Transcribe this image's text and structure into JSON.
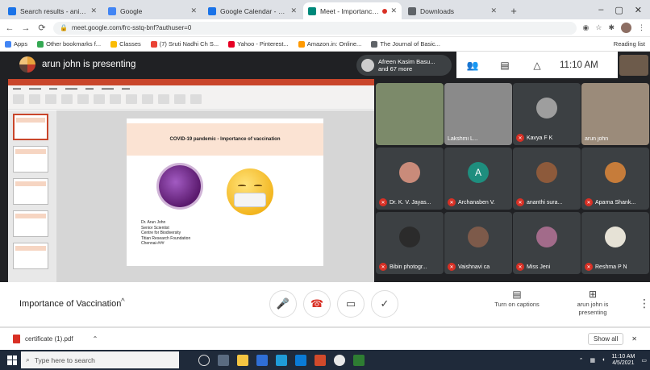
{
  "browser": {
    "tabs": [
      {
        "title": "Search results - anilajayan@...",
        "active": false,
        "color": "#1a73e8"
      },
      {
        "title": "Google",
        "active": false,
        "color": "#4285f4"
      },
      {
        "title": "Google Calendar - Weekly...",
        "active": false,
        "color": "#1a73e8"
      },
      {
        "title": "Meet - Importance of Va...",
        "active": true,
        "color": "#00897b"
      },
      {
        "title": "Downloads",
        "active": false,
        "color": "#5f6368"
      }
    ],
    "new_tab": "+",
    "url": "meet.google.com/frc-sstq-bnf?authuser=0",
    "bookmarks": [
      {
        "label": "Apps",
        "color": "#4285f4"
      },
      {
        "label": "Other bookmarks f...",
        "color": "#34a853"
      },
      {
        "label": "Classes",
        "color": "#fbbc05"
      },
      {
        "label": "(7) Sruti Nadhi Ch S...",
        "color": "#ea4335"
      },
      {
        "label": "Yahoo - Pinterest...",
        "color": "#e60023"
      },
      {
        "label": "Amazon.in: Online...",
        "color": "#ff9900"
      },
      {
        "label": "The Journal of Basic...",
        "color": "#5f6368"
      }
    ],
    "reading_list": "Reading list"
  },
  "meet": {
    "presenting_label": "arun john is presenting",
    "presenter_pill": "Afreen Kasim Basu... and 67 more",
    "clock": "11:10 AM",
    "meeting_title": "Importance of Vaccination",
    "caret": "^",
    "captions_label": "Turn on captions",
    "presenting_ctl_label": "arun john is presenting",
    "participants": [
      {
        "name": "",
        "type": "video",
        "color": "#7c8a6a"
      },
      {
        "name": "Lakshmi L...",
        "type": "video",
        "color": "#8a8a8a"
      },
      {
        "name": "Kavya F K",
        "type": "avatar",
        "color": "#9e9e9e",
        "letter": ""
      },
      {
        "name": "arun john",
        "type": "video",
        "color": "#9b8b7a"
      },
      {
        "name": "Dr. K. V. Jayas...",
        "type": "avatar",
        "color": "#c98b7a",
        "letter": ""
      },
      {
        "name": "Archanaben V.",
        "type": "avatar",
        "color": "#1e8e7e",
        "letter": "A"
      },
      {
        "name": "ananthi sura...",
        "type": "avatar",
        "color": "#8d5a3b",
        "letter": ""
      },
      {
        "name": "Aparna Shank...",
        "type": "avatar",
        "color": "#c67c3a",
        "letter": ""
      },
      {
        "name": "Bibin photogr...",
        "type": "avatar",
        "color": "#2b2b2b",
        "letter": ""
      },
      {
        "name": "Vaishnavi ca",
        "type": "avatar",
        "color": "#7d5a4a",
        "letter": ""
      },
      {
        "name": "Miss Jeni",
        "type": "avatar",
        "color": "#a26b8a",
        "letter": ""
      },
      {
        "name": "Reshma P N",
        "type": "avatar",
        "color": "#e6e2d6",
        "letter": ""
      }
    ]
  },
  "slide": {
    "header": "COVID-19 pandemic - Importance of vaccination",
    "author_lines": [
      "Dr. Arun John",
      "Senior Scientist",
      "Centre for Biodiversity",
      "Titian Research Foundation",
      "Chennai-###"
    ]
  },
  "downloads": {
    "file": "certificate (1).pdf",
    "show_all": "Show all"
  },
  "taskbar": {
    "search_placeholder": "Type here to search",
    "time": "11:10 AM",
    "date": "4/5/2021"
  }
}
